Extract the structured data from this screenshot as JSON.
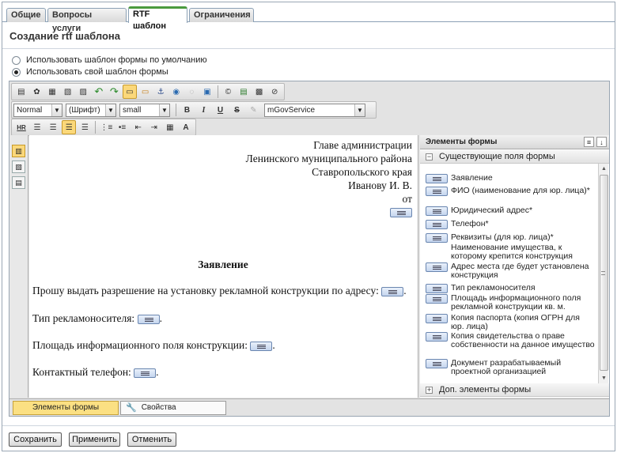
{
  "tabs": [
    {
      "label": "Общие",
      "active": false
    },
    {
      "label": "Вопросы услуги",
      "active": false
    },
    {
      "label": "RTF шаблон",
      "active": true
    },
    {
      "label": "Ограничения",
      "active": false
    }
  ],
  "page_title": "Создание rtf шаблона",
  "template_options": {
    "default_label": "Использовать шаблон формы по умолчанию",
    "custom_label": "Использовать свой шаблон формы",
    "selected": "custom"
  },
  "toolbar": {
    "style_select": "Normal",
    "font_select": "(Шрифт)",
    "size_select": "small",
    "template_select": "mGovService",
    "bold": "B",
    "italic": "I",
    "underline": "U",
    "strike": "S",
    "hr": "HR"
  },
  "document": {
    "right_lines": [
      "Главе администрации",
      "Ленинского муниципального района",
      "Ставропольского края",
      "Иванову И. В.",
      "от"
    ],
    "heading": "Заявление",
    "paragraphs": [
      {
        "text": "Прошу выдать разрешение на установку рекламной конструкции по адресу:",
        "suffix": "."
      },
      {
        "text": "Тип рекламоносителя:",
        "suffix": "."
      },
      {
        "text": "Площадь информационного поля конструкции:",
        "suffix": "."
      },
      {
        "text": "Контактный телефон:",
        "suffix": "."
      }
    ]
  },
  "form_elements_panel": {
    "title": "Элементы формы",
    "group_existing": "Существующие поля формы",
    "group_extra": "Доп. элементы формы",
    "items": [
      "Заявление",
      "ФИО (наименование для юр. лица)*",
      "Юридический адрес*",
      "Телефон*",
      "Реквизиты (для юр. лица)*",
      "Наименование имущества, к которому крепится конструкция",
      "Адрес места где будет установлена конструкция",
      "Тип рекламоносителя",
      "Площадь информационного поля рекламной конструкции кв. м.",
      "Копия паспорта (копия ОГРН для юр. лица)",
      "Копия свидетельства о праве собственности на данное имущество",
      "Документ разрабатываемый проектной организацией"
    ]
  },
  "bottom_tabs": {
    "elements": "Элементы формы",
    "properties": "Свойства"
  },
  "actions": {
    "save": "Сохранить",
    "apply": "Применить",
    "cancel": "Отменить"
  }
}
